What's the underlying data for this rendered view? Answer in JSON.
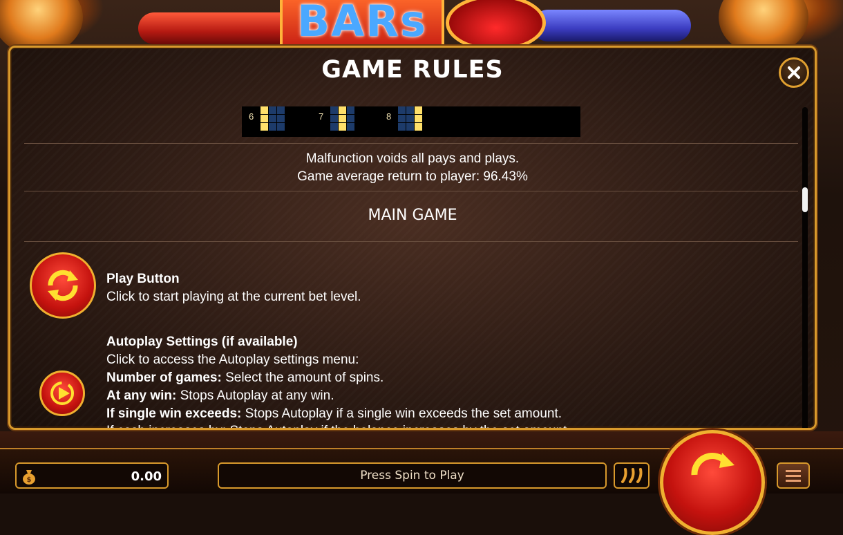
{
  "modal": {
    "title": "GAME RULES",
    "paylines": [
      {
        "number": "6",
        "pattern": [
          [
            1,
            0,
            0
          ],
          [
            1,
            0,
            0
          ],
          [
            1,
            0,
            0
          ]
        ]
      },
      {
        "number": "7",
        "pattern": [
          [
            0,
            1,
            0
          ],
          [
            0,
            1,
            0
          ],
          [
            0,
            1,
            0
          ]
        ]
      },
      {
        "number": "8",
        "pattern": [
          [
            0,
            0,
            1
          ],
          [
            0,
            0,
            1
          ],
          [
            0,
            0,
            1
          ]
        ]
      }
    ],
    "notice_line1": "Malfunction voids all pays and plays.",
    "notice_line2": "Game average return to player: 96.43%",
    "section_title": "MAIN GAME",
    "play_button": {
      "title": "Play Button",
      "text": "Click to start playing at the current bet level."
    },
    "autoplay": {
      "title": "Autoplay Settings (if available)",
      "intro": "Click to access the Autoplay settings menu:",
      "items": [
        {
          "label": "Number of games:",
          "text": " Select the amount of spins."
        },
        {
          "label": "At any win:",
          "text": " Stops Autoplay at any win."
        },
        {
          "label": "If single win exceeds:",
          "text": " Stops Autoplay if a single win exceeds the set amount."
        }
      ],
      "cut_line": "If cash increases by: Stops Autoplay if the balance increases by the set amount."
    }
  },
  "bottom_bar": {
    "balance": "0.00",
    "status_message": "Press Spin to Play"
  },
  "colors": {
    "gold_border": "#d99a2c",
    "button_red": "#c4120e",
    "arrow_yellow": "#ffe030"
  }
}
